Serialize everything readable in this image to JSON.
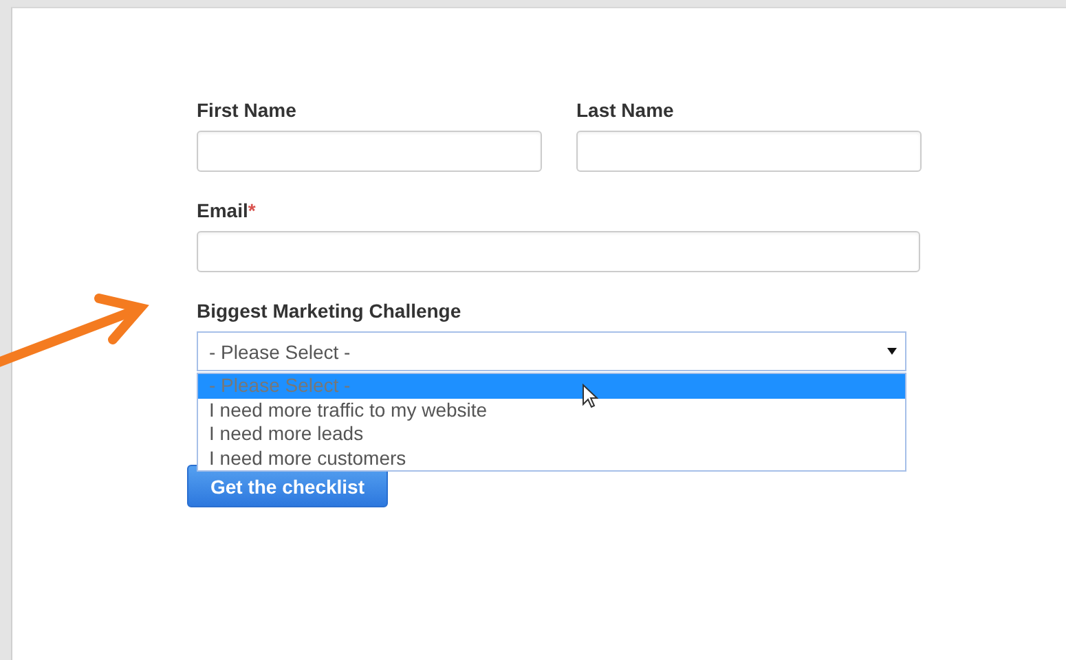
{
  "form": {
    "fields": [
      {
        "label": "First Name",
        "kind": "text"
      },
      {
        "label": "Last Name",
        "kind": "text"
      },
      {
        "label": "Email",
        "required_mark": "*",
        "kind": "text"
      },
      {
        "label": "Biggest Marketing Challenge",
        "kind": "select",
        "value": "- Please Select -",
        "expanded": true,
        "options": [
          {
            "label": "- Please Select -",
            "selected": true
          },
          {
            "label": "I need more traffic to my website",
            "selected": false
          },
          {
            "label": "I need more leads",
            "selected": false
          },
          {
            "label": "I need more customers",
            "selected": false
          }
        ]
      }
    ],
    "submit_button": "Get the checklist"
  }
}
